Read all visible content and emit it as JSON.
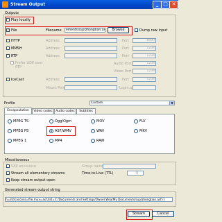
{
  "window": {
    "title": "Stream Output",
    "minimize": "_",
    "maximize": "□",
    "close": "✕"
  },
  "outputs": {
    "group_label": "Outputs",
    "play_locally": "Play locally",
    "file": {
      "label": "File",
      "filename_label": "Filename",
      "filename_value": "ements\\sup\\zhongtian.asf",
      "browse": "Browse",
      "dump_raw": "Dump raw input"
    },
    "http": {
      "label": "HTTP",
      "address_label": "Address",
      "port_label": "Port",
      "port_value": "8080"
    },
    "mmsh": {
      "label": "MMSH",
      "address_label": "Address",
      "port_label": "Port",
      "port_value": "1234"
    },
    "rtp": {
      "label": "RTP",
      "address_label": "Address",
      "port_label": "Port",
      "port_value": "1234",
      "prefer_udp": "Prefer UDP over RTP",
      "audio_port_label": "Audio Port",
      "audio_port_value": "1234",
      "video_port_label": "Video Port",
      "video_port_value": "1234"
    },
    "icecast": {
      "label": "IceCast",
      "address_label": "Address",
      "port_label": "Port",
      "port_value": "1234",
      "mount_label": "Mount Point",
      "login_label": "Login:pass"
    }
  },
  "profile": {
    "label": "Profile",
    "value": "Custom"
  },
  "tabs": [
    "Encapsulation",
    "Video codec",
    "Audio codec",
    "Subtitles"
  ],
  "encapsulation": {
    "col1": [
      "MPEG TS",
      "MPEG PS",
      "MPEG 1"
    ],
    "col2": [
      "Ogg/Ogm",
      "ASF/WMV",
      "MP4"
    ],
    "col3": [
      "MOV",
      "WAV",
      "RAW"
    ],
    "col4": [
      "FLV",
      "MKV"
    ],
    "selected": "ASF/WMV"
  },
  "misc": {
    "group_label": "Miscellaneous",
    "sap": "SAP announce",
    "group_name_label": "Group name",
    "stream_all": "Stream all elementary streams",
    "ttl_label": "Time-to-Live (TTL)",
    "ttl_value": "1",
    "keep_open": "Keep stream output open"
  },
  "generated": {
    "group_label": "Generated stream output string",
    "value": "h=std{access=file,mux=asf,dst=C:/Documents and Settings/Owner.Wea/My Documents/sup/zhongtian.asf}}"
  },
  "buttons": {
    "stream": "Stream",
    "cancel": "Cancel"
  },
  "colors": {
    "highlight": "#DD1111",
    "titlebar": "#0A5FE0"
  }
}
